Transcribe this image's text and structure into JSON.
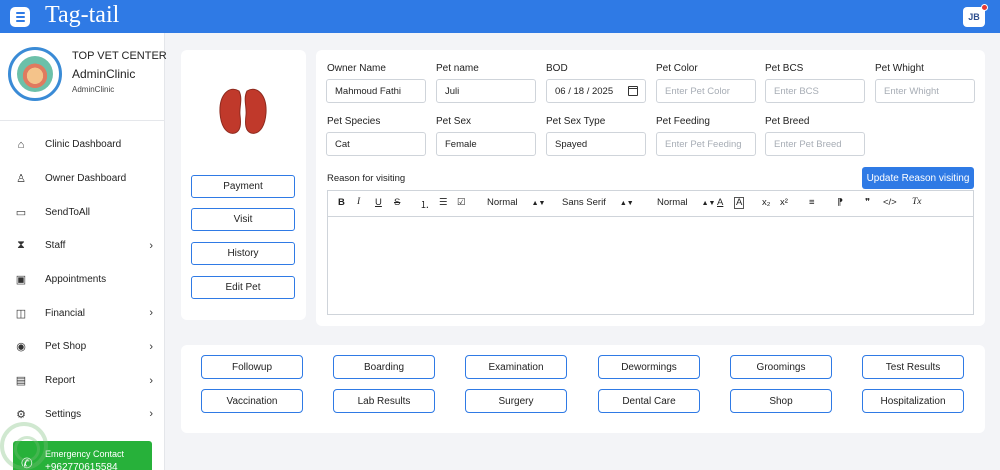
{
  "app": {
    "title": "Tag-tail",
    "user_initials": "JB"
  },
  "clinic": {
    "name": "TOP VET CENTER",
    "subtitle": "AdminClinic",
    "role": "AdminClinic"
  },
  "sidebar": {
    "items": [
      {
        "label": "Clinic Dashboard",
        "icon": "home-icon",
        "has_submenu": false
      },
      {
        "label": "Owner Dashboard",
        "icon": "user-icon",
        "has_submenu": false
      },
      {
        "label": "SendToAll",
        "icon": "chat-icon",
        "has_submenu": false
      },
      {
        "label": "Staff",
        "icon": "hourglass-icon",
        "has_submenu": true
      },
      {
        "label": "Appointments",
        "icon": "calendar-icon",
        "has_submenu": false
      },
      {
        "label": "Financial",
        "icon": "wallet-icon",
        "has_submenu": true
      },
      {
        "label": "Pet Shop",
        "icon": "coin-icon",
        "has_submenu": true
      },
      {
        "label": "Report",
        "icon": "report-icon",
        "has_submenu": true
      },
      {
        "label": "Settings",
        "icon": "gear-icon",
        "has_submenu": true
      }
    ],
    "chevron": "›",
    "emergency": {
      "label": "Emergency Contact",
      "phone": "+962770615584"
    }
  },
  "pet_actions": [
    "Payment",
    "Visit",
    "History",
    "Edit Pet"
  ],
  "form": {
    "owner_name": {
      "label": "Owner Name",
      "value": "Mahmoud Fathi"
    },
    "pet_name": {
      "label": "Pet name",
      "value": "Juli"
    },
    "bod": {
      "label": "BOD",
      "value": "06 / 18 / 2025"
    },
    "pet_color": {
      "label": "Pet Color",
      "placeholder": "Enter Pet Color"
    },
    "pet_bcs": {
      "label": "Pet BCS",
      "placeholder": "Enter BCS"
    },
    "pet_whight": {
      "label": "Pet Whight",
      "placeholder": "Enter Whight"
    },
    "pet_species": {
      "label": "Pet Species",
      "value": "Cat"
    },
    "pet_sex": {
      "label": "Pet Sex",
      "value": "Female"
    },
    "pet_sex_type": {
      "label": "Pet Sex Type",
      "value": "Spayed"
    },
    "pet_feeding": {
      "label": "Pet Feeding",
      "placeholder": "Enter Pet Feeding"
    },
    "pet_breed": {
      "label": "Pet Breed",
      "placeholder": "Enter Pet Breed"
    },
    "reason_label": "Reason for visiting",
    "update_button": "Update Reason visiting"
  },
  "editor_toolbar": {
    "bold": "B",
    "italic": "I",
    "underline": "U",
    "strike": "S",
    "ordered_list": "⒈",
    "bullet_list": "☰",
    "check_list": "☑",
    "header_select": "Normal",
    "font_select": "Sans Serif",
    "size_select": "Normal",
    "color": "A",
    "background": "A",
    "subscript": "x₂",
    "superscript": "x²",
    "align": "≡",
    "direction": "⁋",
    "blockquote": "❞",
    "code": "</>",
    "clean": "Tx"
  },
  "tabs": [
    [
      "Followup",
      "Boarding",
      "Examination",
      "Dewormings",
      "Groomings",
      "Test Results"
    ],
    [
      "Vaccination",
      "Lab Results",
      "Surgery",
      "Dental Care",
      "Shop",
      "Hospitalization"
    ]
  ],
  "colors": {
    "primary": "#2f7ae5",
    "emergency": "#27b13a",
    "organ": "#c0392b"
  }
}
